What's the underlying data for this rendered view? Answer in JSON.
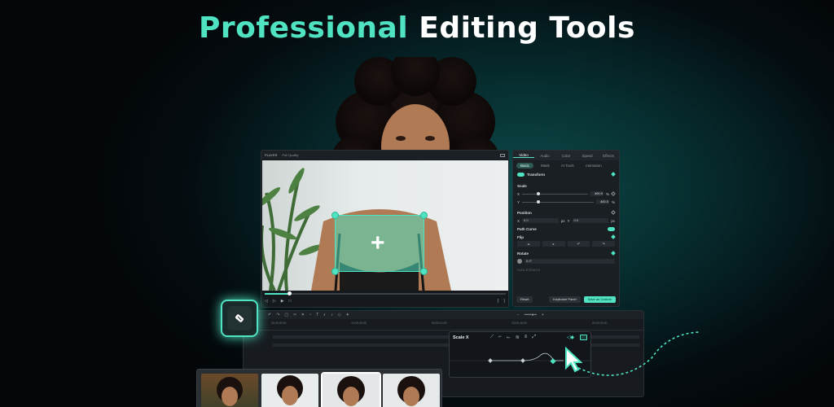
{
  "headline": {
    "accent": "Professional",
    "rest": "Editing Tools"
  },
  "player": {
    "title": "PLAYER",
    "quality": "Full Quality",
    "progress": 0.1
  },
  "panel": {
    "tabs": [
      "Video",
      "Audio",
      "Color",
      "Speed",
      "Effects"
    ],
    "subtabs": [
      "Basic",
      "Mask",
      "AI Tools",
      "Animation"
    ],
    "transform": "Transform",
    "scale": "Scale",
    "scale_x": "X",
    "scale_y": "Y",
    "scale_x_value": "400.0",
    "scale_y_value": "400.0",
    "unit_pct": "%",
    "position": "Position",
    "pos_x_label": "X",
    "pos_x_value": "0.0",
    "pos_y_label": "Y",
    "pos_y_value": "0.0",
    "unit_px": "px",
    "path_curve": "Path Curve",
    "flip": "Flip",
    "rotate": "Rotate",
    "rotate_value": "0.0°",
    "blend": "Auto Enhance",
    "reset": "Reset",
    "keyframe_panel": "Keyframe Panel",
    "save_custom": "Save as Custom"
  },
  "timeline": {
    "ruler": [
      "00:00:00:00",
      "00:00:05:00",
      "00:00:10:00",
      "00:00:15:00",
      "00:00:20:00"
    ]
  },
  "scalex": {
    "title": "Scale X"
  },
  "icons": {
    "feature": "keyframe-tag-icon",
    "cursor": "arrow-cursor-icon"
  },
  "colors": {
    "accent": "#4fe3c1",
    "background": "#040c10"
  }
}
